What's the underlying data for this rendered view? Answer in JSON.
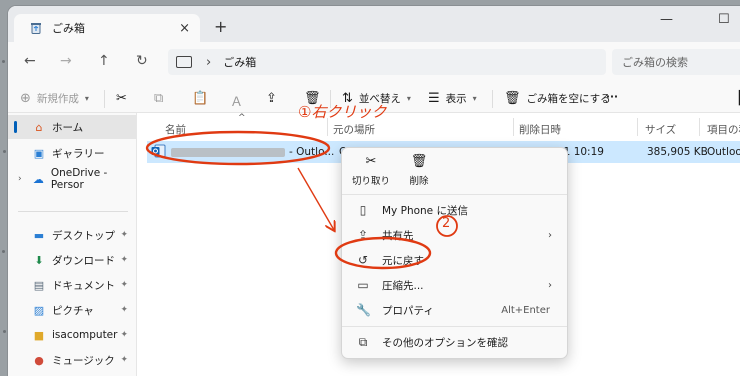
{
  "window": {
    "tab_title": "ごみ箱",
    "tab_close": "×",
    "tab_add": "+",
    "minimize": "—",
    "maximize": "☐"
  },
  "address": {
    "breadcrumb_sep": "›",
    "path": "ごみ箱",
    "search_placeholder": "ごみ箱の検索"
  },
  "toolbar": {
    "new_label": "新規作成",
    "sort_label": "並べ替え",
    "view_label": "表示",
    "empty_recycle_label": "ごみ箱を空にする",
    "more_label": "···"
  },
  "sidebar": {
    "items": [
      {
        "label": "ホーム"
      },
      {
        "label": "ギャラリー"
      },
      {
        "label": "OneDrive - Persor"
      },
      {
        "label": "デスクトップ"
      },
      {
        "label": "ダウンロード"
      },
      {
        "label": "ドキュメント"
      },
      {
        "label": "ピクチャ"
      },
      {
        "label": "isacomputer"
      },
      {
        "label": "ミュージック"
      }
    ],
    "pin_glyph": "📌"
  },
  "list": {
    "columns": [
      "名前",
      "元の場所",
      "削除日時",
      "サイズ",
      "項目の種"
    ],
    "row": {
      "name_suffix": "- Outlo...",
      "location": "C",
      "deleted": "11 10:19",
      "size": "385,905 KB",
      "type": "Outlook"
    }
  },
  "context_menu": {
    "top_actions": [
      {
        "label": "切り取り"
      },
      {
        "label": "削除"
      }
    ],
    "items": [
      {
        "label": "My Phone に送信"
      },
      {
        "label": "共有先"
      },
      {
        "label": "元に戻す"
      },
      {
        "label": "圧縮先..."
      },
      {
        "label": "プロパティ",
        "accel": "Alt+Enter"
      },
      {
        "label": "その他のオプションを確認"
      }
    ]
  },
  "annotations": {
    "step1": "①右クリック",
    "step2": "②"
  },
  "colors": {
    "annotation": "#e03a12",
    "selection": "#cce8ff",
    "accent": "#005fb8"
  }
}
